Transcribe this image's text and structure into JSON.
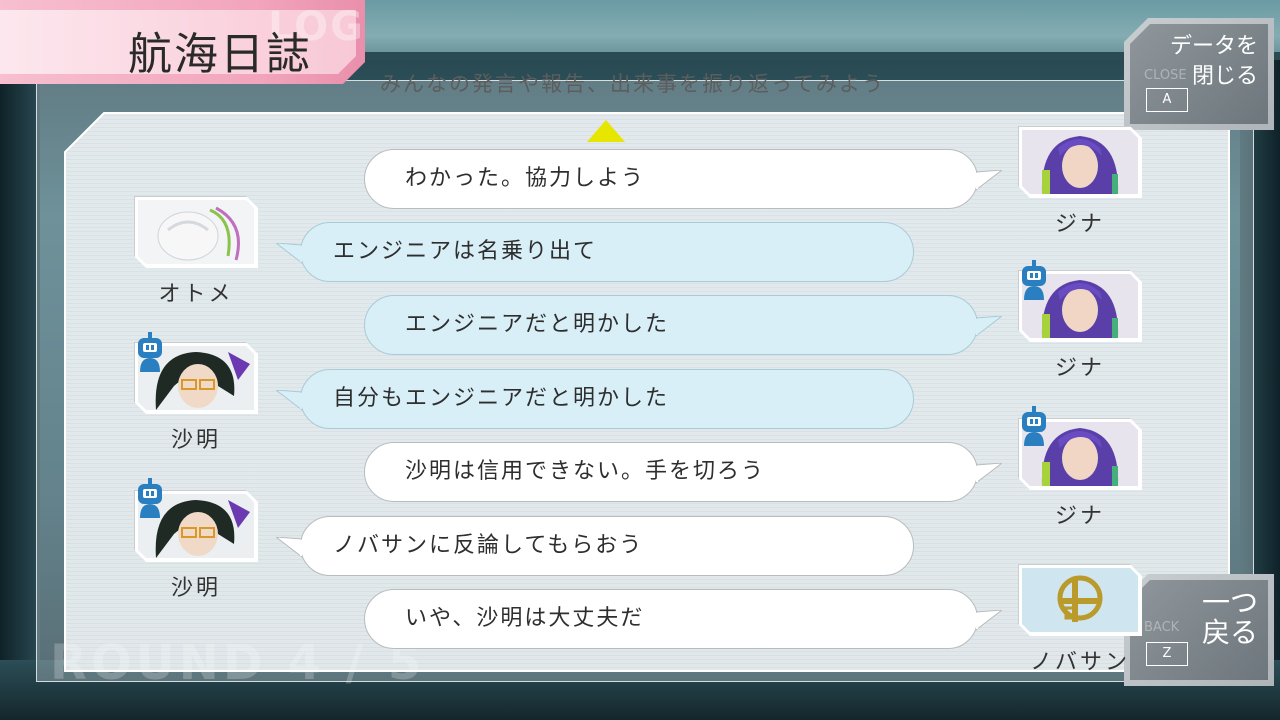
{
  "header": {
    "title": "航海日誌",
    "title_ghost": "LOG",
    "subtitle": "みんなの発言や報告、出来事を振り返ってみよう"
  },
  "footer": {
    "round_ghost": "ROUND 4 / 5"
  },
  "buttons": {
    "close": {
      "label": "データを\n閉じる",
      "ghost": "CLOSE",
      "key": "A"
    },
    "back": {
      "label": "一つ\n戻る",
      "ghost": "BACK",
      "key": "Z"
    }
  },
  "log": [
    {
      "speaker": "ジナ",
      "side": "right",
      "text": "わかった。協力しよう",
      "style": "white",
      "badge": false
    },
    {
      "speaker": "オトメ",
      "side": "left",
      "text": "エンジニアは名乗り出て",
      "style": "blue",
      "badge": false
    },
    {
      "speaker": "ジナ",
      "side": "right",
      "text": "エンジニアだと明かした",
      "style": "blue",
      "badge": true
    },
    {
      "speaker": "沙明",
      "side": "left",
      "text": "自分もエンジニアだと明かした",
      "style": "blue",
      "badge": true
    },
    {
      "speaker": "ジナ",
      "side": "right",
      "text": "沙明は信用できない。手を切ろう",
      "style": "white",
      "badge": true
    },
    {
      "speaker": "沙明",
      "side": "left",
      "text": "ノバサンに反論してもらおう",
      "style": "white",
      "badge": true
    },
    {
      "speaker": "ノバサン",
      "side": "right",
      "text": "いや、沙明は大丈夫だ",
      "style": "white",
      "badge": false
    }
  ],
  "colors": {
    "title_pink": "#f2a5bc",
    "bubble_blue": "#d8eff8",
    "bubble_white": "#ffffff",
    "badge_blue": "#2a7fc0",
    "arrow_yellow": "#e6e600"
  },
  "icons": {
    "scroll": "triangle-up-icon",
    "badge": "engineer-robot-icon"
  }
}
